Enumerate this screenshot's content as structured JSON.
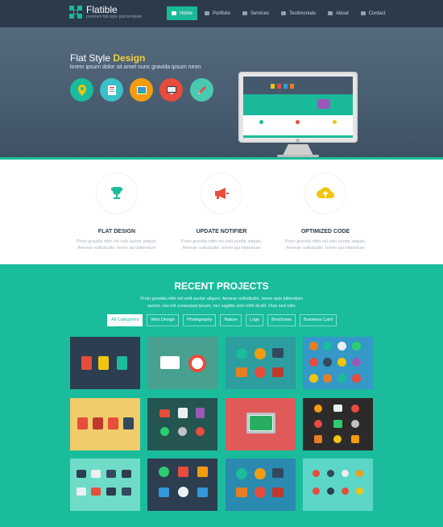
{
  "header": {
    "brand": "Flatible",
    "tagline": "premium flat style psd template",
    "menu": [
      {
        "label": "Home",
        "icon": "home-icon",
        "active": true
      },
      {
        "label": "Portfolio",
        "icon": "portfolio-icon",
        "active": false
      },
      {
        "label": "Services",
        "icon": "services-icon",
        "active": false
      },
      {
        "label": "Testimonials",
        "icon": "testimonials-icon",
        "active": false
      },
      {
        "label": "About",
        "icon": "about-icon",
        "active": false
      },
      {
        "label": "Contact",
        "icon": "contact-icon",
        "active": false
      }
    ]
  },
  "hero": {
    "title_prefix": "Flat Style",
    "title_highlight": "Design",
    "subtitle": "lorem ipsum dolor sit amet nunc gravida ipsum neon",
    "icons": [
      {
        "name": "location-pin-icon",
        "bg": "#1abc9c"
      },
      {
        "name": "document-icon",
        "bg": "#3bc0c7"
      },
      {
        "name": "picture-icon",
        "bg": "#f39c12"
      },
      {
        "name": "computer-icon",
        "bg": "#e74c3c"
      },
      {
        "name": "pencil-icon",
        "bg": "#48c9b0"
      }
    ]
  },
  "features": [
    {
      "title": "FLAT DESIGN",
      "icon": "trophy-icon",
      "color": "#1abc9c",
      "text1": "Proin gravida nibh vel velit auctor aliquet,",
      "text2": "Aenean sollicitudin, lorem qui bibendum"
    },
    {
      "title": "UPDATE NOTIFIER",
      "icon": "megaphone-icon",
      "color": "#e74c3c",
      "text1": "Proin gravida nibh vel velit auctor aliquet,",
      "text2": "Aenean sollicitudin, lorem qui bibendum"
    },
    {
      "title": "OPTIMIZED CODE",
      "icon": "cloud-upload-icon",
      "color": "#f1c40f",
      "text1": "Proin gravida nibh vel velit auctor aliquet,",
      "text2": "Aenean sollicitudin, lorem qui bibendum"
    }
  ],
  "projects": {
    "title": "RECENT PROJECTS",
    "subtitle1": "Proin gravida nibh vel velit auctor aliquet. Aenean sollicitudin, lorem quis bibendum",
    "subtitle2": "auctor, nisi elit consequat ipsum, nec sagittis sem nibh id elit. Duis sed odio",
    "filters": [
      "All Categories",
      "Web Design",
      "Photography",
      "Nature",
      "Logo",
      "Brochures",
      "Business Card"
    ],
    "tile_colors": [
      "#2c3e50",
      "#48a090",
      "#2c9ea0",
      "#3498c8",
      "#f0cc6a",
      "#245550",
      "#e05a5a",
      "#2c2a2a",
      "#6fdcc8",
      "#2c3e50",
      "#2a8ab0",
      "#5cd6c6"
    ]
  }
}
